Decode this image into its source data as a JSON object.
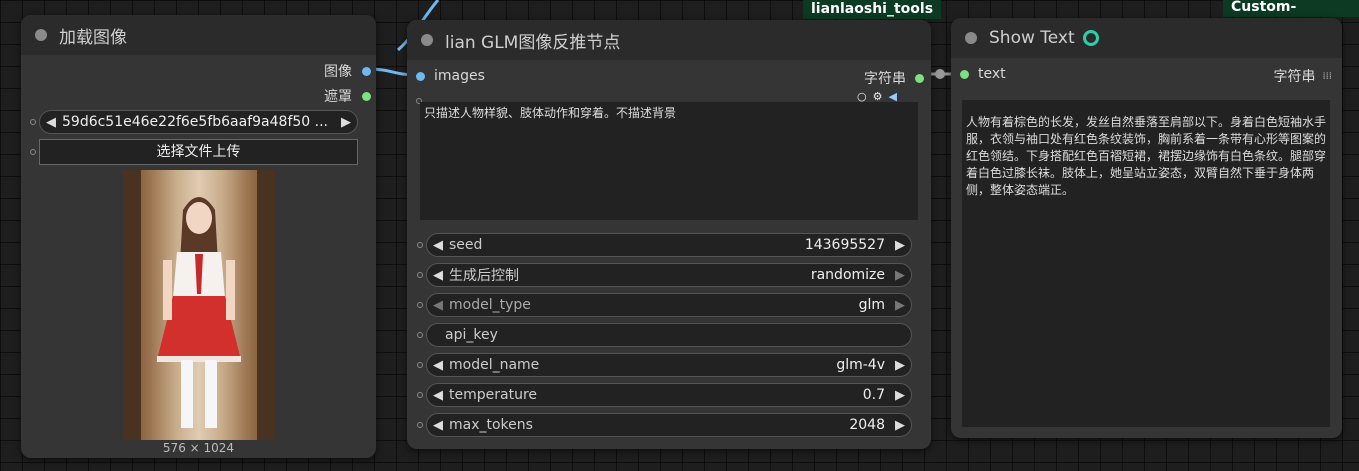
{
  "load_node": {
    "title": "加载图像",
    "out_image": "图像",
    "out_mask": "遮罩",
    "image_name": "59d6c51e46e22f6e5fb6aaf9a48f50 ...",
    "upload_label": "选择文件上传",
    "dims": "576 × 1024"
  },
  "glm_node": {
    "badge": "lianlaoshi_tools",
    "title": "lian GLM图像反推节点",
    "input_images": "images",
    "output_string": "字符串",
    "prompt": "只描述人物样貌、肢体动作和穿着。不描述背景",
    "widgets": [
      {
        "label": "seed",
        "value": "143695527"
      },
      {
        "label": "生成后控制",
        "value": "randomize"
      },
      {
        "label": "model_type",
        "value": "glm"
      },
      {
        "label": "api_key",
        "value": ""
      },
      {
        "label": "model_name",
        "value": "glm-4v"
      },
      {
        "label": "temperature",
        "value": "0.7"
      },
      {
        "label": "max_tokens",
        "value": "2048"
      }
    ]
  },
  "show_node": {
    "badge": "Custom-Scripts",
    "title": "Show Text",
    "input_text": "text",
    "type_label": "字符串",
    "content": "人物有着棕色的长发，发丝自然垂落至肩部以下。身着白色短袖水手服，衣领与袖口处有红色条纹装饰，胸前系着一条带有心形等图案的红色领结。下身搭配红色百褶短裙，裙摆边缘饰有白色条纹。腿部穿着白色过膝长袜。肢体上，她呈站立姿态，双臂自然下垂于身体两侧，整体姿态端正。"
  },
  "colors": {
    "image_link": "#6fb8f0",
    "string_link": "#7ee07e",
    "badge_bg": "#0c3a23"
  }
}
